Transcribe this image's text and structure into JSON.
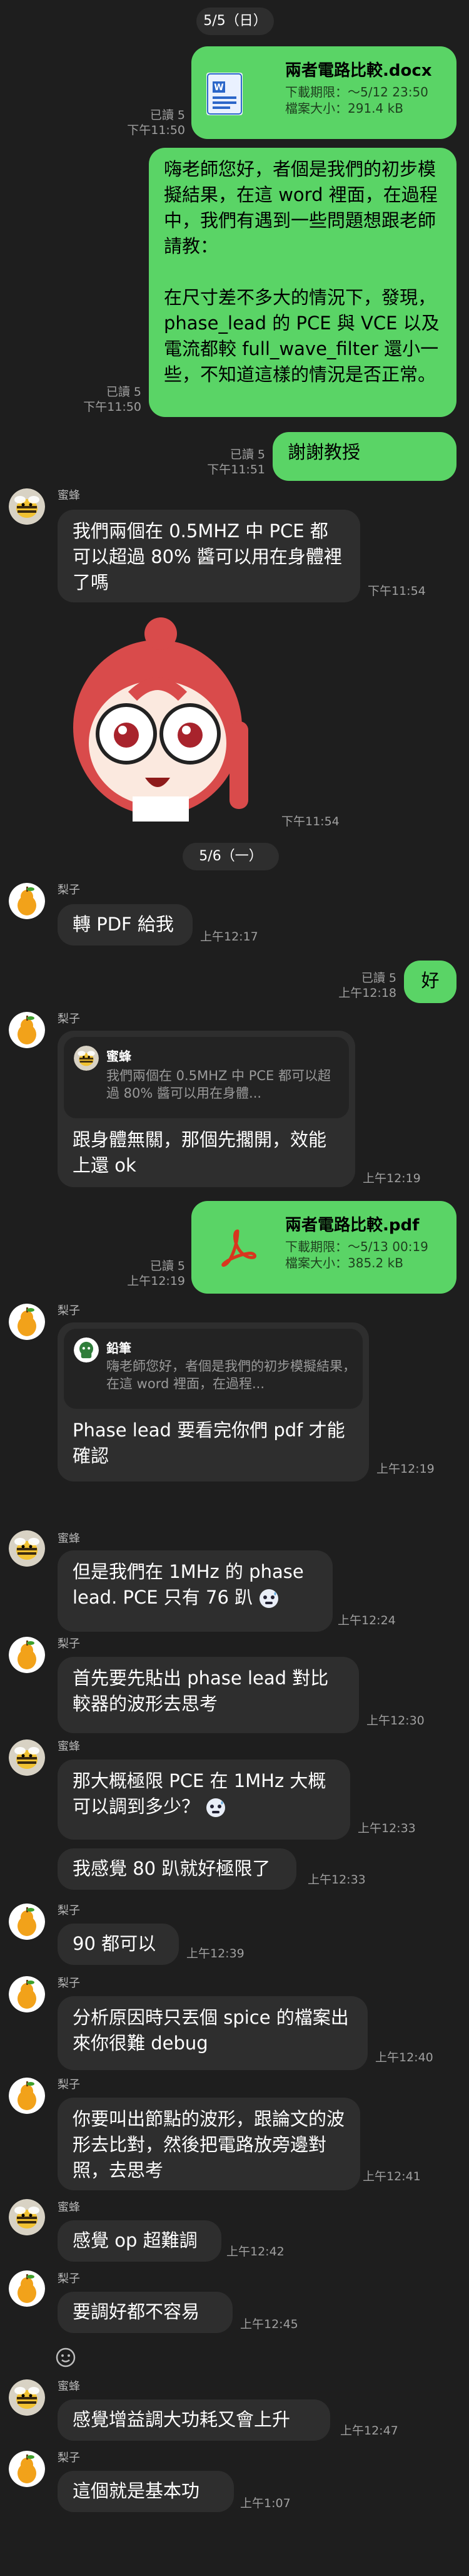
{
  "dates": {
    "d1": "5/5（日）",
    "d2": "5/6（一）"
  },
  "senders": {
    "bee": "蜜蜂",
    "pear": "梨子",
    "pencil": "鉛筆"
  },
  "icons": {
    "bee": "bee-avatar-icon",
    "pear": "pear-avatar-icon",
    "pencil": "pencil-avatar-icon",
    "word": "word-file-icon",
    "pdf": "pdf-file-icon",
    "smile": "smile-reaction-icon"
  },
  "colors": {
    "background": "#1e1e1e",
    "bubble_in": "#2e2e2e",
    "bubble_out": "#5ad466"
  },
  "messages": {
    "m1": {
      "file_name": "兩者電路比較.docx",
      "file_expiry": "下載期限：～5/12 23:50",
      "file_size": "檔案大小：291.4 kB",
      "read": "已讀 5",
      "time": "下午11:50"
    },
    "m2": {
      "text": "嗨老師您好，者個是我們的初步模擬結果，在這 word 裡面，在過程中，我們有遇到一些問題想跟老師請教：\n\n在尺寸差不多大的情況下，發現，phase_lead 的 PCE 與 VCE 以及電流都較 full_wave_filter 還小一些，不知道這樣的情況是否正常。",
      "read": "已讀 5",
      "time": "下午11:50"
    },
    "m3": {
      "text": "謝謝教授",
      "read": "已讀 5",
      "time": "下午11:51"
    },
    "m4": {
      "text": "我們兩個在 0.5MHZ 中 PCE 都可以超過 80% 醬可以用在身體裡了嗎",
      "time": "下午11:54"
    },
    "m5": {
      "time": "下午11:54"
    },
    "m6": {
      "text": "轉 PDF 給我",
      "time": "上午12:17"
    },
    "m7": {
      "text": "好",
      "read": "已讀 5",
      "time": "上午12:18"
    },
    "m8": {
      "quote_text": "我們兩個在 0.5MHZ 中 PCE 都可以超過 80% 醬可以用在身體...",
      "text": "跟身體無關，那個先擱開，效能上還 ok",
      "time": "上午12:19"
    },
    "m9": {
      "file_name": "兩者電路比較.pdf",
      "file_expiry": "下載期限：～5/13 00:19",
      "file_size": "檔案大小：385.2 kB",
      "read": "已讀 5",
      "time": "上午12:19"
    },
    "m10": {
      "quote_text": "嗨老師您好，者個是我們的初步模擬結果，在這 word 裡面，在過程...",
      "text": "Phase lead 要看完你們 pdf 才能確認",
      "time": "上午12:19"
    },
    "m11": {
      "text": "但是我們在 1MHz 的 phase lead. PCE 只有 76 趴",
      "time": "上午12:24"
    },
    "m12": {
      "text": "首先要先貼出 phase lead 對比較器的波形去思考",
      "time": "上午12:30"
    },
    "m13": {
      "text": "那大概極限 PCE 在 1MHz 大概可以調到多少？",
      "time": "上午12:33"
    },
    "m14": {
      "text": "我感覺 80 趴就好極限了",
      "time": "上午12:33"
    },
    "m15": {
      "text": "90 都可以",
      "time": "上午12:39"
    },
    "m16": {
      "text": "分析原因時只丟個 spice 的檔案出來你很難 debug",
      "time": "上午12:40"
    },
    "m17": {
      "text": "你要叫出節點的波形，跟論文的波形去比對，然後把電路放旁邊對照，去思考",
      "time": "上午12:41"
    },
    "m18": {
      "text": "感覺 op 超難調",
      "time": "上午12:42"
    },
    "m19": {
      "text": "要調好都不容易",
      "time": "上午12:45"
    },
    "m20": {
      "text": "感覺增益調大功耗又會上升",
      "time": "上午12:47"
    },
    "m21": {
      "text": "這個就是基本功",
      "time": "上午1:07"
    }
  }
}
